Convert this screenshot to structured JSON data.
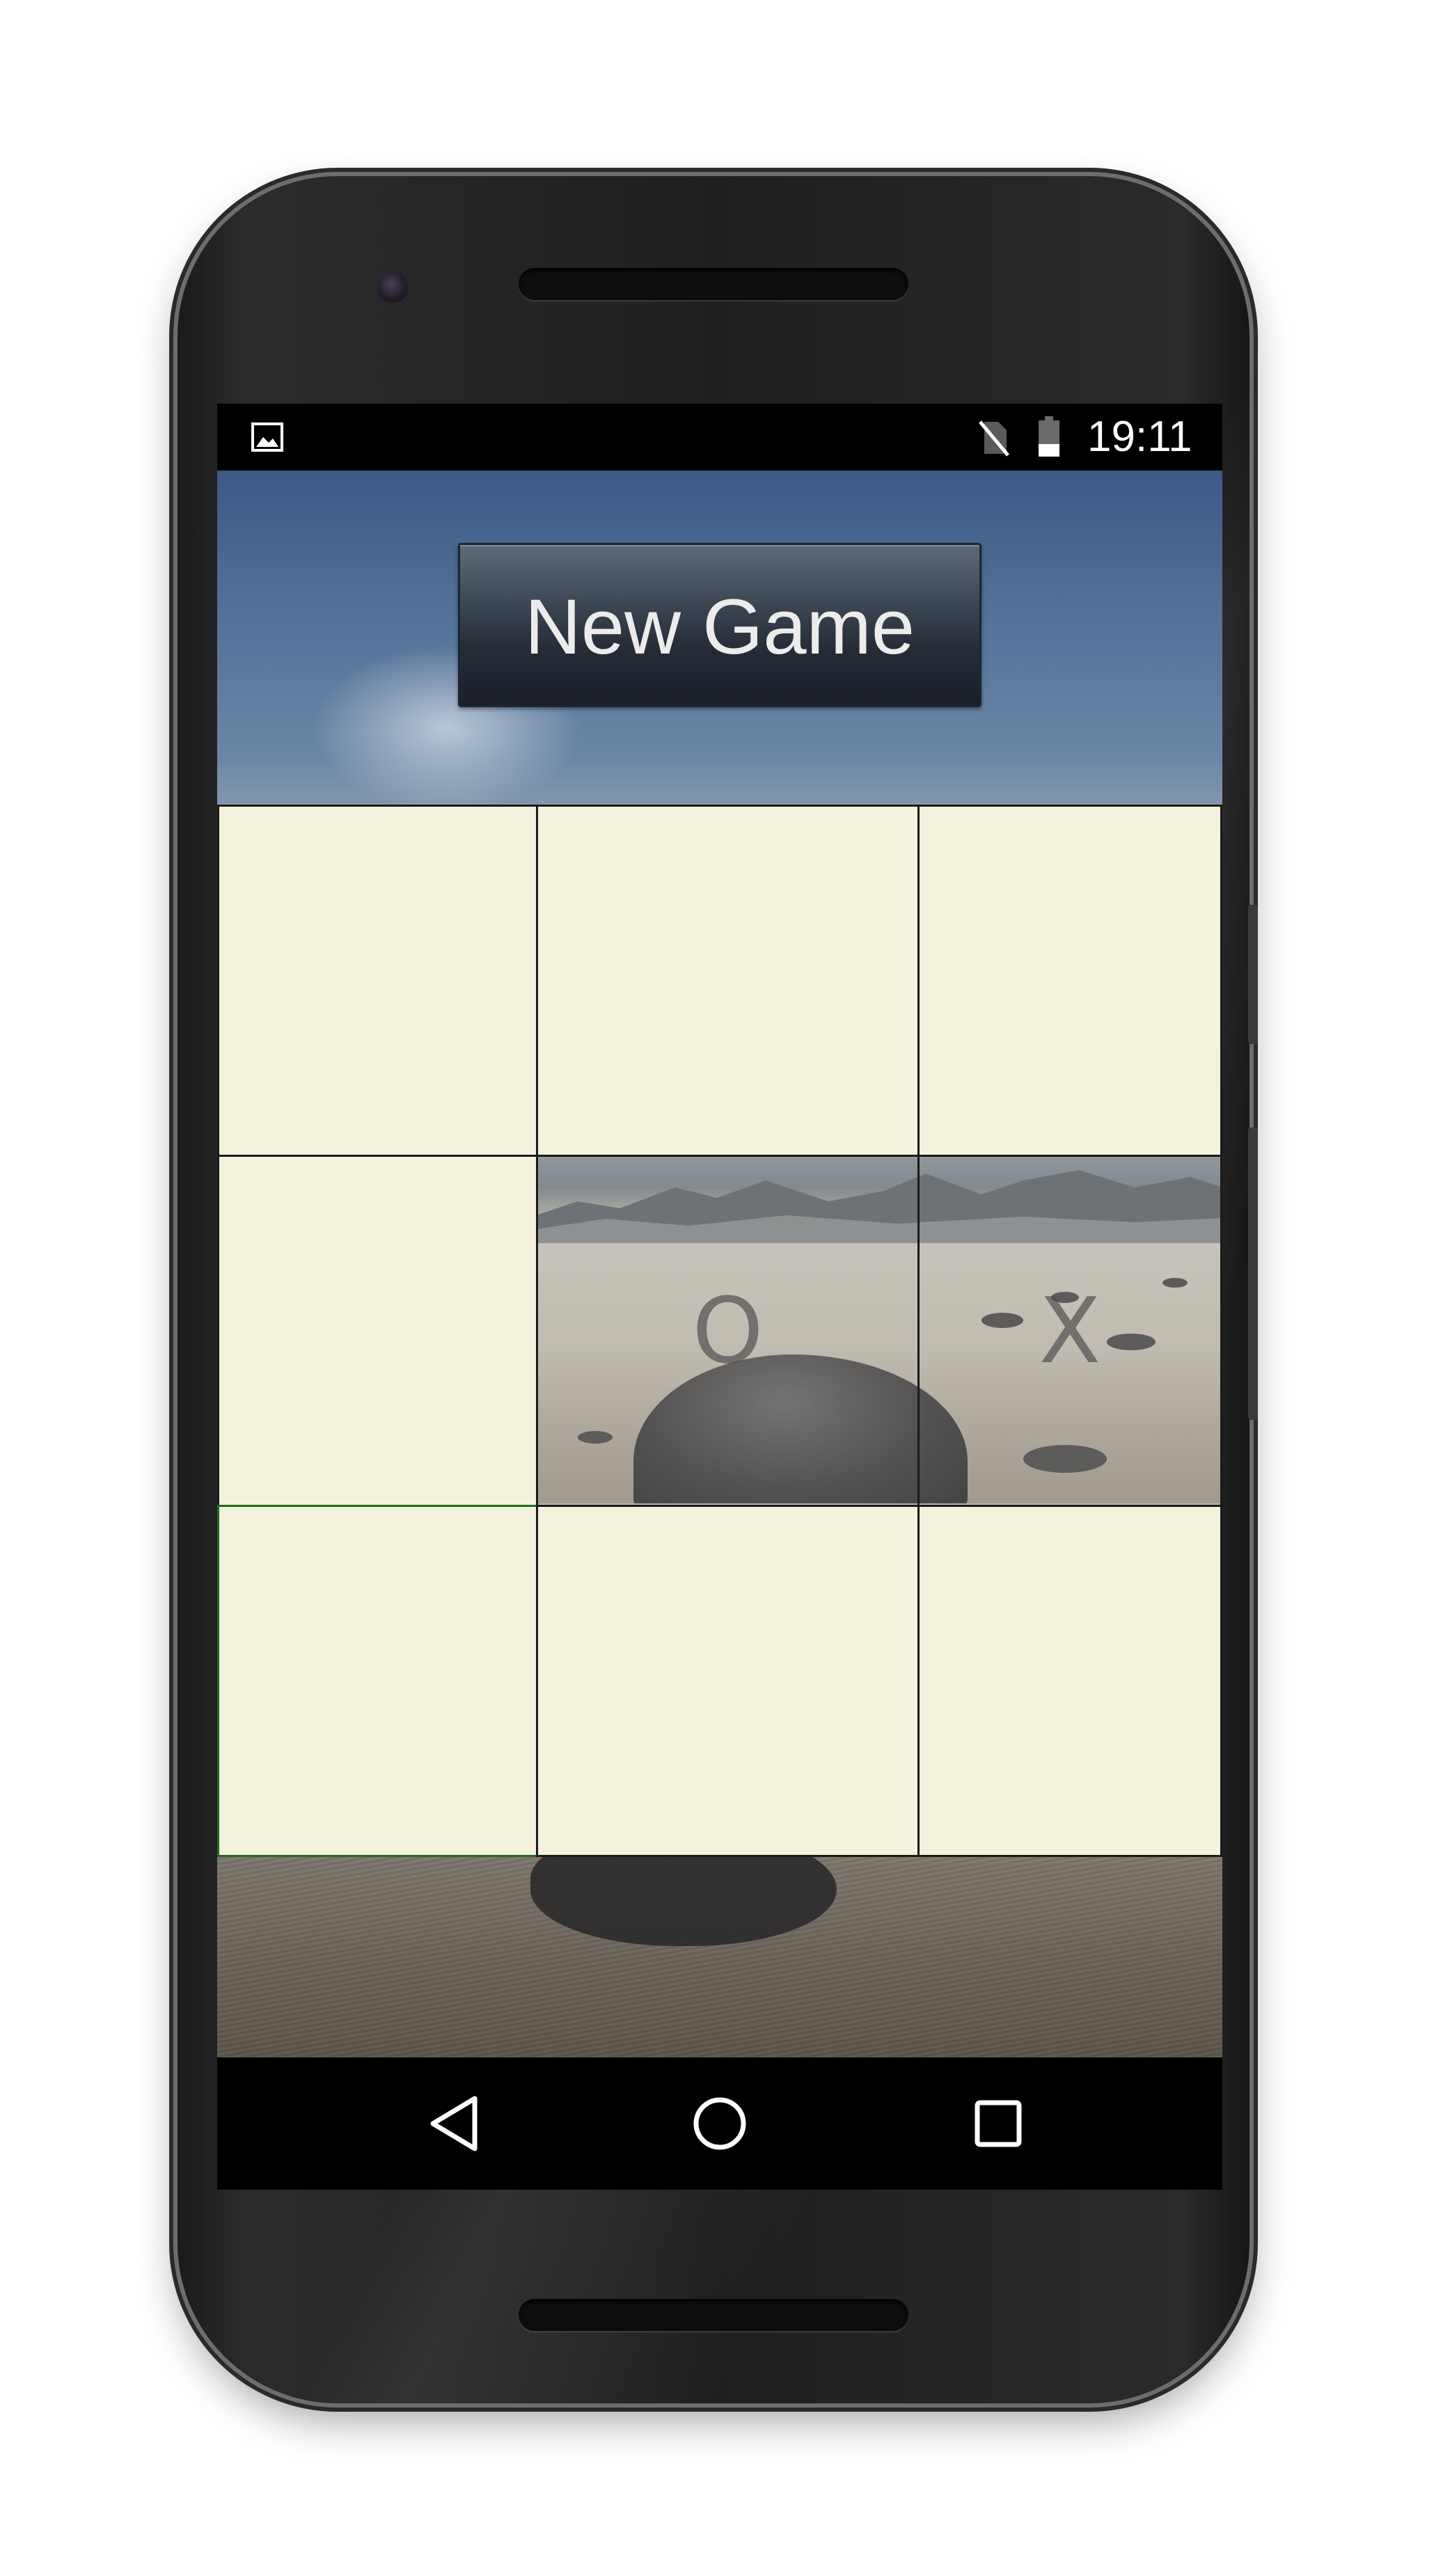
{
  "status_bar": {
    "time": "19:11",
    "icons": [
      "gallery-icon",
      "sim-off-icon",
      "battery-icon"
    ]
  },
  "app": {
    "new_game_label": "New Game"
  },
  "board": {
    "cells": [
      {
        "row": 1,
        "col": 1,
        "mark": ""
      },
      {
        "row": 1,
        "col": 2,
        "mark": ""
      },
      {
        "row": 1,
        "col": 3,
        "mark": ""
      },
      {
        "row": 2,
        "col": 1,
        "mark": ""
      },
      {
        "row": 2,
        "col": 2,
        "mark": "O"
      },
      {
        "row": 2,
        "col": 3,
        "mark": "X"
      },
      {
        "row": 3,
        "col": 1,
        "mark": ""
      },
      {
        "row": 3,
        "col": 2,
        "mark": ""
      },
      {
        "row": 3,
        "col": 3,
        "mark": ""
      }
    ],
    "empty_cell_color": "#f4f2dc",
    "grid_line_color": "#1a1a1a",
    "highlight_color": "#1f6b1f"
  },
  "nav_bar": {
    "buttons": [
      "back-icon",
      "home-icon",
      "recents-icon"
    ]
  }
}
